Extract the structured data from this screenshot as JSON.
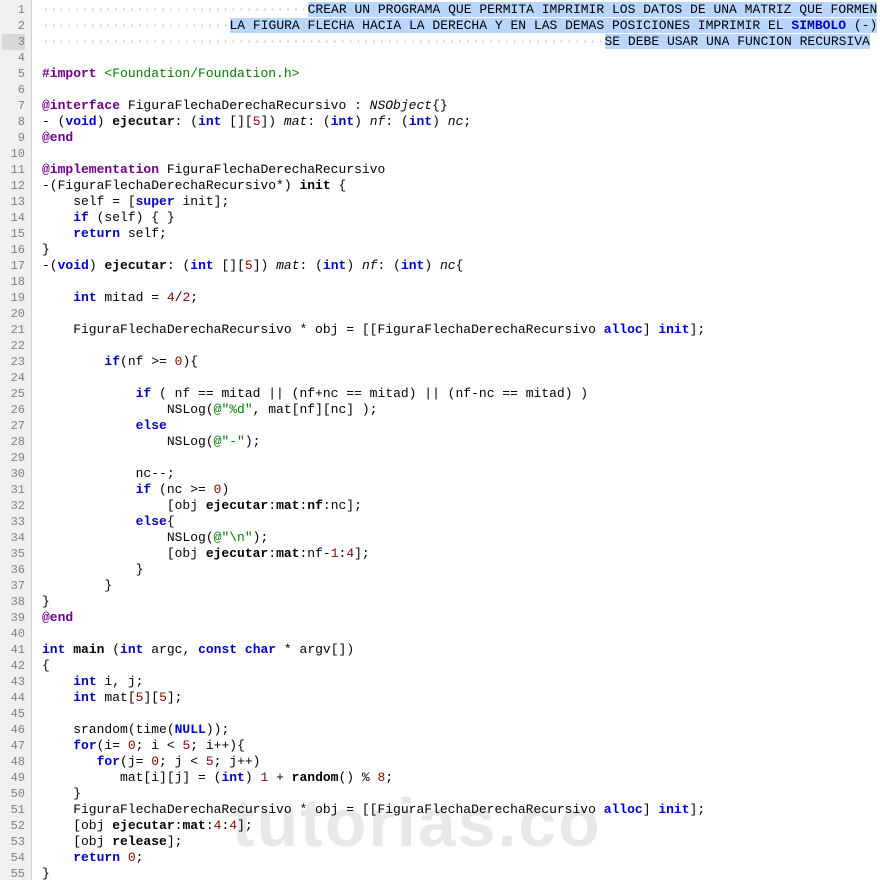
{
  "watermark": "tutorias.co",
  "line_count": 55,
  "current_line": 3,
  "tokens": {
    "l1": [
      {
        "t": "·",
        "c": "c-ws",
        "rep": 34
      },
      {
        "t": "CREAR",
        "c": "c-sel"
      },
      {
        "t": "·",
        "c": "c-ws c-sel"
      },
      {
        "t": "UN",
        "c": "c-sel"
      },
      {
        "t": "·",
        "c": "c-ws c-sel"
      },
      {
        "t": "PROGRAMA",
        "c": "c-sel"
      },
      {
        "t": "·",
        "c": "c-ws c-sel"
      },
      {
        "t": "QUE",
        "c": "c-sel"
      },
      {
        "t": "·",
        "c": "c-ws c-sel"
      },
      {
        "t": "PERMITA",
        "c": "c-sel"
      },
      {
        "t": "·",
        "c": "c-ws c-sel"
      },
      {
        "t": "IMPRIMIR",
        "c": "c-sel"
      },
      {
        "t": "·",
        "c": "c-ws c-sel"
      },
      {
        "t": "LOS",
        "c": "c-sel"
      },
      {
        "t": "·",
        "c": "c-ws c-sel"
      },
      {
        "t": "DATOS",
        "c": "c-sel"
      },
      {
        "t": "·",
        "c": "c-ws c-sel"
      },
      {
        "t": "DE",
        "c": "c-sel"
      },
      {
        "t": "·",
        "c": "c-ws c-sel"
      },
      {
        "t": "UNA",
        "c": "c-sel"
      },
      {
        "t": "·",
        "c": "c-ws c-sel"
      },
      {
        "t": "MATRIZ",
        "c": "c-sel"
      },
      {
        "t": "·",
        "c": "c-ws c-sel"
      },
      {
        "t": "QUE",
        "c": "c-sel"
      },
      {
        "t": "·",
        "c": "c-ws c-sel"
      },
      {
        "t": "FORMEN",
        "c": "c-sel"
      }
    ],
    "l2": [
      {
        "t": "·",
        "c": "c-ws",
        "rep": 24
      },
      {
        "t": "LA",
        "c": "c-sel"
      },
      {
        "t": "·",
        "c": "c-ws c-sel"
      },
      {
        "t": "FIGURA",
        "c": "c-sel"
      },
      {
        "t": "·",
        "c": "c-ws c-sel"
      },
      {
        "t": "FLECHA",
        "c": "c-sel"
      },
      {
        "t": "·",
        "c": "c-ws c-sel"
      },
      {
        "t": "HACIA",
        "c": "c-sel"
      },
      {
        "t": "·",
        "c": "c-ws c-sel"
      },
      {
        "t": "LA",
        "c": "c-sel"
      },
      {
        "t": "·",
        "c": "c-ws c-sel"
      },
      {
        "t": "DERECHA",
        "c": "c-sel"
      },
      {
        "t": "·",
        "c": "c-ws c-sel"
      },
      {
        "t": "Y",
        "c": "c-sel"
      },
      {
        "t": "·",
        "c": "c-ws c-sel"
      },
      {
        "t": "EN",
        "c": "c-sel"
      },
      {
        "t": "·",
        "c": "c-ws c-sel"
      },
      {
        "t": "LAS",
        "c": "c-sel"
      },
      {
        "t": "·",
        "c": "c-ws c-sel"
      },
      {
        "t": "DEMAS",
        "c": "c-sel"
      },
      {
        "t": "·",
        "c": "c-ws c-sel"
      },
      {
        "t": "POSICIONES",
        "c": "c-sel"
      },
      {
        "t": "·",
        "c": "c-ws c-sel"
      },
      {
        "t": "IMPRIMIR",
        "c": "c-sel"
      },
      {
        "t": "·",
        "c": "c-ws c-sel"
      },
      {
        "t": "EL",
        "c": "c-sel"
      },
      {
        "t": "·",
        "c": "c-ws c-sel"
      },
      {
        "t": "SIMBOLO",
        "c": "c-sel c-kw"
      },
      {
        "t": "·",
        "c": "c-ws c-sel"
      },
      {
        "t": "(-)",
        "c": "c-sel"
      }
    ],
    "l3": [
      {
        "t": "·",
        "c": "c-ws",
        "rep": 72
      },
      {
        "t": "SE",
        "c": "c-sel"
      },
      {
        "t": "·",
        "c": "c-ws c-sel"
      },
      {
        "t": "DEBE",
        "c": "c-sel"
      },
      {
        "t": "·",
        "c": "c-ws c-sel"
      },
      {
        "t": "USAR",
        "c": "c-sel"
      },
      {
        "t": "·",
        "c": "c-ws c-sel"
      },
      {
        "t": "UNA",
        "c": "c-sel"
      },
      {
        "t": "·",
        "c": "c-ws c-sel"
      },
      {
        "t": "FUNCION",
        "c": "c-sel"
      },
      {
        "t": "·",
        "c": "c-ws c-sel"
      },
      {
        "t": "RECURSIVA",
        "c": "c-sel"
      }
    ],
    "l4": [],
    "l5": [
      {
        "t": "#import ",
        "c": "c-dir"
      },
      {
        "t": "<Foundation/Foundation.h>",
        "c": "c-inc"
      }
    ],
    "l6": [],
    "l7": [
      {
        "t": "@interface",
        "c": "c-dir"
      },
      {
        "t": " FiguraFlechaDerechaRecursivo : ",
        "c": "c-id"
      },
      {
        "t": "NSObject",
        "c": "c-ns"
      },
      {
        "t": "{}",
        "c": "c-id"
      }
    ],
    "l8": [
      {
        "t": "- (",
        "c": "c-id"
      },
      {
        "t": "void",
        "c": "c-kw"
      },
      {
        "t": ") ",
        "c": "c-id"
      },
      {
        "t": "ejecutar",
        "c": "c-fn"
      },
      {
        "t": ": (",
        "c": "c-id"
      },
      {
        "t": "int",
        "c": "c-kw"
      },
      {
        "t": " [][",
        "c": "c-id"
      },
      {
        "t": "5",
        "c": "c-num"
      },
      {
        "t": "]) ",
        "c": "c-id"
      },
      {
        "t": "mat",
        "c": "c-it"
      },
      {
        "t": ": (",
        "c": "c-id"
      },
      {
        "t": "int",
        "c": "c-kw"
      },
      {
        "t": ") ",
        "c": "c-id"
      },
      {
        "t": "nf",
        "c": "c-it"
      },
      {
        "t": ": (",
        "c": "c-id"
      },
      {
        "t": "int",
        "c": "c-kw"
      },
      {
        "t": ") ",
        "c": "c-id"
      },
      {
        "t": "nc",
        "c": "c-it"
      },
      {
        "t": ";",
        "c": "c-id"
      }
    ],
    "l9": [
      {
        "t": "@end",
        "c": "c-dir"
      }
    ],
    "l10": [],
    "l11": [
      {
        "t": "@implementation",
        "c": "c-dir"
      },
      {
        "t": " FiguraFlechaDerechaRecursivo",
        "c": "c-id"
      }
    ],
    "l12": [
      {
        "t": "-(FiguraFlechaDerechaRecursivo*) ",
        "c": "c-id"
      },
      {
        "t": "init",
        "c": "c-fn"
      },
      {
        "t": " {",
        "c": "c-id"
      }
    ],
    "l13": [
      {
        "t": "    self = [",
        "c": "c-id"
      },
      {
        "t": "super",
        "c": "c-kw"
      },
      {
        "t": " ",
        "c": "c-id"
      },
      {
        "t": "init",
        "c": "c-id"
      },
      {
        "t": "];",
        "c": "c-id"
      }
    ],
    "l14": [
      {
        "t": "    ",
        "c": ""
      },
      {
        "t": "if",
        "c": "c-kw"
      },
      {
        "t": " (self) { }",
        "c": "c-id"
      }
    ],
    "l15": [
      {
        "t": "    ",
        "c": ""
      },
      {
        "t": "return",
        "c": "c-kw"
      },
      {
        "t": " self;",
        "c": "c-id"
      }
    ],
    "l16": [
      {
        "t": "}",
        "c": "c-id"
      }
    ],
    "l17": [
      {
        "t": "-(",
        "c": "c-id"
      },
      {
        "t": "void",
        "c": "c-kw"
      },
      {
        "t": ") ",
        "c": "c-id"
      },
      {
        "t": "ejecutar",
        "c": "c-fn"
      },
      {
        "t": ": (",
        "c": "c-id"
      },
      {
        "t": "int",
        "c": "c-kw"
      },
      {
        "t": " [][",
        "c": "c-id"
      },
      {
        "t": "5",
        "c": "c-num"
      },
      {
        "t": "]) ",
        "c": "c-id"
      },
      {
        "t": "mat",
        "c": "c-it"
      },
      {
        "t": ": (",
        "c": "c-id"
      },
      {
        "t": "int",
        "c": "c-kw"
      },
      {
        "t": ") ",
        "c": "c-id"
      },
      {
        "t": "nf",
        "c": "c-it"
      },
      {
        "t": ": (",
        "c": "c-id"
      },
      {
        "t": "int",
        "c": "c-kw"
      },
      {
        "t": ") ",
        "c": "c-id"
      },
      {
        "t": "nc",
        "c": "c-it"
      },
      {
        "t": "{",
        "c": "c-id"
      }
    ],
    "l18": [],
    "l19": [
      {
        "t": "    ",
        "c": ""
      },
      {
        "t": "int",
        "c": "c-kw"
      },
      {
        "t": " mitad = ",
        "c": "c-id"
      },
      {
        "t": "4",
        "c": "c-num"
      },
      {
        "t": "/",
        "c": "c-id"
      },
      {
        "t": "2",
        "c": "c-num"
      },
      {
        "t": ";",
        "c": "c-id"
      }
    ],
    "l20": [],
    "l21": [
      {
        "t": "    FiguraFlechaDerechaRecursivo * obj = [[FiguraFlechaDerechaRecursivo ",
        "c": "c-id"
      },
      {
        "t": "alloc",
        "c": "c-kw"
      },
      {
        "t": "] ",
        "c": "c-id"
      },
      {
        "t": "init",
        "c": "c-kw"
      },
      {
        "t": "];",
        "c": "c-id"
      }
    ],
    "l22": [],
    "l23": [
      {
        "t": "        ",
        "c": ""
      },
      {
        "t": "if",
        "c": "c-kw"
      },
      {
        "t": "(nf >= ",
        "c": "c-id"
      },
      {
        "t": "0",
        "c": "c-num"
      },
      {
        "t": "){",
        "c": "c-id"
      }
    ],
    "l24": [],
    "l25": [
      {
        "t": "            ",
        "c": ""
      },
      {
        "t": "if",
        "c": "c-kw"
      },
      {
        "t": " ( nf == mitad || (nf+nc == mitad) || (nf-nc == mitad) )",
        "c": "c-id"
      }
    ],
    "l26": [
      {
        "t": "                NSLog(",
        "c": "c-id"
      },
      {
        "t": "@\"%d\"",
        "c": "c-str"
      },
      {
        "t": ", mat[nf][nc] );",
        "c": "c-id"
      }
    ],
    "l27": [
      {
        "t": "            ",
        "c": ""
      },
      {
        "t": "else",
        "c": "c-kw"
      }
    ],
    "l28": [
      {
        "t": "                NSLog(",
        "c": "c-id"
      },
      {
        "t": "@\"-\"",
        "c": "c-str"
      },
      {
        "t": ");",
        "c": "c-id"
      }
    ],
    "l29": [],
    "l30": [
      {
        "t": "            nc--;",
        "c": "c-id"
      }
    ],
    "l31": [
      {
        "t": "            ",
        "c": ""
      },
      {
        "t": "if",
        "c": "c-kw"
      },
      {
        "t": " (nc >= ",
        "c": "c-id"
      },
      {
        "t": "0",
        "c": "c-num"
      },
      {
        "t": ")",
        "c": "c-id"
      }
    ],
    "l32": [
      {
        "t": "                [obj ",
        "c": "c-id"
      },
      {
        "t": "ejecutar",
        "c": "c-fn"
      },
      {
        "t": ":",
        "c": "c-id"
      },
      {
        "t": "mat",
        "c": "c-fn"
      },
      {
        "t": ":",
        "c": "c-id"
      },
      {
        "t": "nf",
        "c": "c-fn"
      },
      {
        "t": ":nc];",
        "c": "c-id"
      }
    ],
    "l33": [
      {
        "t": "            ",
        "c": ""
      },
      {
        "t": "else",
        "c": "c-kw"
      },
      {
        "t": "{",
        "c": "c-id"
      }
    ],
    "l34": [
      {
        "t": "                NSLog(",
        "c": "c-id"
      },
      {
        "t": "@\"\\n\"",
        "c": "c-str"
      },
      {
        "t": ");",
        "c": "c-id"
      }
    ],
    "l35": [
      {
        "t": "                [obj ",
        "c": "c-id"
      },
      {
        "t": "ejecutar",
        "c": "c-fn"
      },
      {
        "t": ":",
        "c": "c-id"
      },
      {
        "t": "mat",
        "c": "c-fn"
      },
      {
        "t": ":nf-",
        "c": "c-id"
      },
      {
        "t": "1",
        "c": "c-num"
      },
      {
        "t": ":",
        "c": "c-id"
      },
      {
        "t": "4",
        "c": "c-num"
      },
      {
        "t": "];",
        "c": "c-id"
      }
    ],
    "l36": [
      {
        "t": "            }",
        "c": "c-id"
      }
    ],
    "l37": [
      {
        "t": "        }",
        "c": "c-id"
      }
    ],
    "l38": [
      {
        "t": "}",
        "c": "c-id"
      }
    ],
    "l39": [
      {
        "t": "@end",
        "c": "c-dir"
      }
    ],
    "l40": [],
    "l41": [
      {
        "t": "int",
        "c": "c-kw"
      },
      {
        "t": " ",
        "c": ""
      },
      {
        "t": "main",
        "c": "c-fn"
      },
      {
        "t": " (",
        "c": "c-id"
      },
      {
        "t": "int",
        "c": "c-kw"
      },
      {
        "t": " argc, ",
        "c": "c-id"
      },
      {
        "t": "const",
        "c": "c-kw"
      },
      {
        "t": " ",
        "c": ""
      },
      {
        "t": "char",
        "c": "c-kw"
      },
      {
        "t": " * argv[])",
        "c": "c-id"
      }
    ],
    "l42": [
      {
        "t": "{",
        "c": "c-id"
      }
    ],
    "l43": [
      {
        "t": "    ",
        "c": ""
      },
      {
        "t": "int",
        "c": "c-kw"
      },
      {
        "t": " i, j;",
        "c": "c-id"
      }
    ],
    "l44": [
      {
        "t": "    ",
        "c": ""
      },
      {
        "t": "int",
        "c": "c-kw"
      },
      {
        "t": " mat[",
        "c": "c-id"
      },
      {
        "t": "5",
        "c": "c-num"
      },
      {
        "t": "][",
        "c": "c-id"
      },
      {
        "t": "5",
        "c": "c-num"
      },
      {
        "t": "];",
        "c": "c-id"
      }
    ],
    "l45": [],
    "l46": [
      {
        "t": "    srandom(time(",
        "c": "c-id"
      },
      {
        "t": "NULL",
        "c": "c-kw"
      },
      {
        "t": "));",
        "c": "c-id"
      }
    ],
    "l47": [
      {
        "t": "    ",
        "c": ""
      },
      {
        "t": "for",
        "c": "c-kw"
      },
      {
        "t": "(i= ",
        "c": "c-id"
      },
      {
        "t": "0",
        "c": "c-num"
      },
      {
        "t": "; i < ",
        "c": "c-id"
      },
      {
        "t": "5",
        "c": "c-num"
      },
      {
        "t": "; i++){",
        "c": "c-id"
      }
    ],
    "l48": [
      {
        "t": "       ",
        "c": ""
      },
      {
        "t": "for",
        "c": "c-kw"
      },
      {
        "t": "(j= ",
        "c": "c-id"
      },
      {
        "t": "0",
        "c": "c-num"
      },
      {
        "t": "; j < ",
        "c": "c-id"
      },
      {
        "t": "5",
        "c": "c-num"
      },
      {
        "t": "; j++)",
        "c": "c-id"
      }
    ],
    "l49": [
      {
        "t": "          mat[i][j] = (",
        "c": "c-id"
      },
      {
        "t": "int",
        "c": "c-kw"
      },
      {
        "t": ") ",
        "c": "c-id"
      },
      {
        "t": "1",
        "c": "c-num"
      },
      {
        "t": " + ",
        "c": "c-id"
      },
      {
        "t": "random",
        "c": "c-fn"
      },
      {
        "t": "() % ",
        "c": "c-id"
      },
      {
        "t": "8",
        "c": "c-num"
      },
      {
        "t": ";",
        "c": "c-id"
      }
    ],
    "l50": [
      {
        "t": "    }",
        "c": "c-id"
      }
    ],
    "l51": [
      {
        "t": "    FiguraFlechaDerechaRecursivo * obj = [[FiguraFlechaDerechaRecursivo ",
        "c": "c-id"
      },
      {
        "t": "alloc",
        "c": "c-kw"
      },
      {
        "t": "] ",
        "c": "c-id"
      },
      {
        "t": "init",
        "c": "c-kw"
      },
      {
        "t": "];",
        "c": "c-id"
      }
    ],
    "l52": [
      {
        "t": "    [obj ",
        "c": "c-id"
      },
      {
        "t": "ejecutar",
        "c": "c-fn"
      },
      {
        "t": ":",
        "c": "c-id"
      },
      {
        "t": "mat",
        "c": "c-fn"
      },
      {
        "t": ":",
        "c": "c-id"
      },
      {
        "t": "4",
        "c": "c-num"
      },
      {
        "t": ":",
        "c": "c-id"
      },
      {
        "t": "4",
        "c": "c-num"
      },
      {
        "t": "];",
        "c": "c-id"
      }
    ],
    "l53": [
      {
        "t": "    [obj ",
        "c": "c-id"
      },
      {
        "t": "release",
        "c": "c-fn"
      },
      {
        "t": "];",
        "c": "c-id"
      }
    ],
    "l54": [
      {
        "t": "    ",
        "c": ""
      },
      {
        "t": "return",
        "c": "c-kw"
      },
      {
        "t": " ",
        "c": ""
      },
      {
        "t": "0",
        "c": "c-num"
      },
      {
        "t": ";",
        "c": "c-id"
      }
    ],
    "l55": [
      {
        "t": "}",
        "c": "c-id"
      }
    ]
  }
}
